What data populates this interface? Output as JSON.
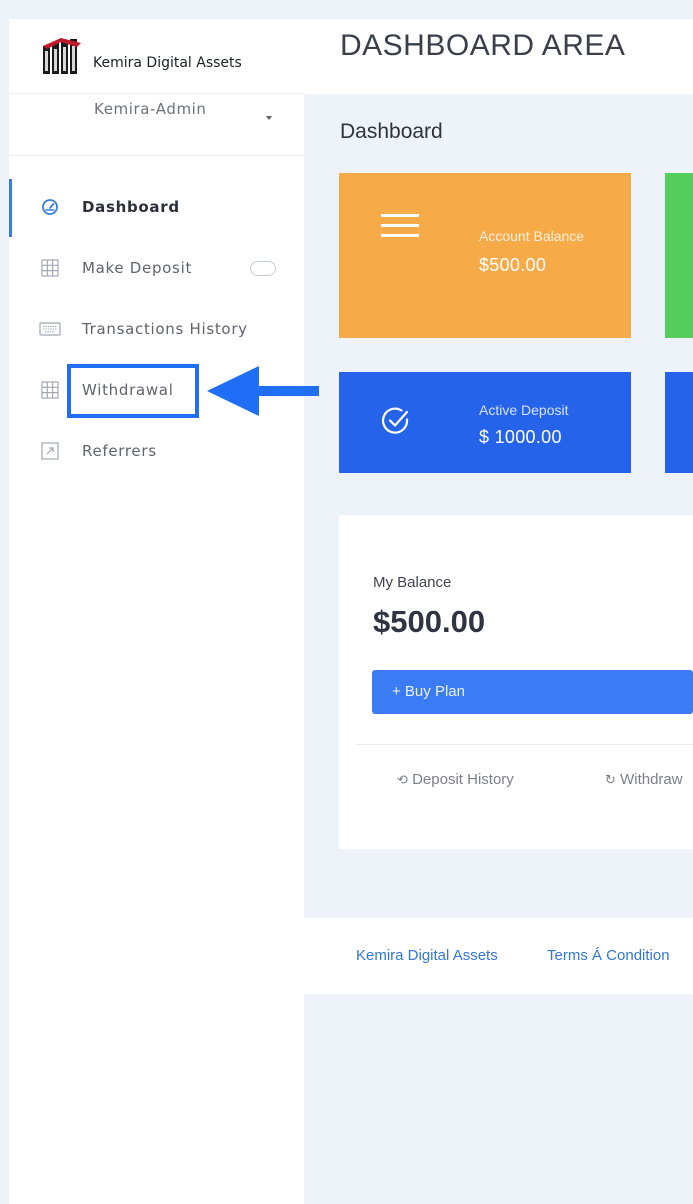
{
  "brand": {
    "name": "Kemira Digital Assets"
  },
  "user": {
    "name": "Kemira-Admin"
  },
  "sidebar": {
    "items": [
      {
        "label": "Dashboard",
        "icon": "speedometer-icon",
        "active": true
      },
      {
        "label": "Make Deposit",
        "icon": "grid-icon"
      },
      {
        "label": "Transactions History",
        "icon": "keyboard-icon"
      },
      {
        "label": "Withdrawal",
        "icon": "grid-icon",
        "highlighted": true
      },
      {
        "label": "Referrers",
        "icon": "arrow-up-right-icon"
      }
    ]
  },
  "header": {
    "title": "DASHBOARD AREA"
  },
  "main": {
    "page_title": "Dashboard",
    "cards": [
      {
        "label": "Account Balance",
        "value": "$500.00",
        "color": "#f6ab48",
        "icon": "menu-icon"
      },
      {
        "label": "",
        "value": "",
        "color": "#55ce5e",
        "icon": ""
      },
      {
        "label": "Active Deposit",
        "value": "$ 1000.00",
        "color": "#2563eb",
        "icon": "check-circle-icon"
      },
      {
        "label": "",
        "value": "",
        "color": "#2563eb",
        "icon": ""
      }
    ],
    "balance": {
      "label": "My Balance",
      "value": "$500.00",
      "buy_label": "+ Buy Plan",
      "deposit_history": "Deposit History",
      "withdraw": "Withdraw"
    }
  },
  "footer": {
    "links": [
      "Kemira Digital Assets",
      "Terms Á Condition"
    ]
  },
  "colors": {
    "accent": "#3b7ddd",
    "highlight": "#1f6ef5",
    "orange": "#f6ab48",
    "green": "#55ce5e",
    "blue": "#2563eb"
  }
}
